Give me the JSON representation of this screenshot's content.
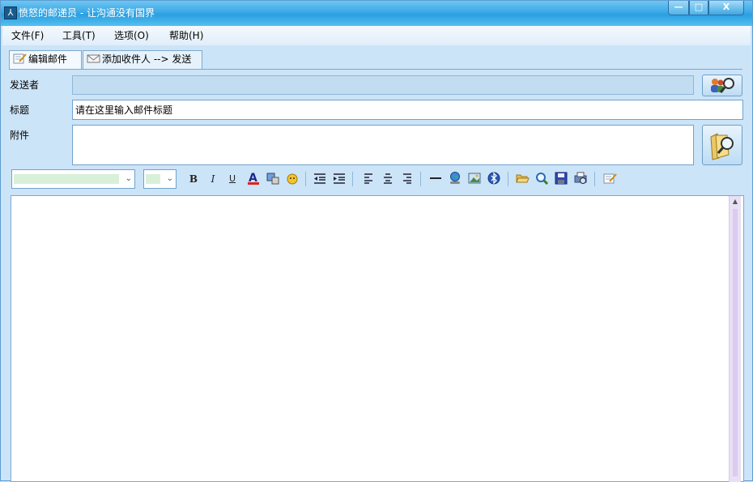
{
  "window": {
    "title": "愤怒的邮递员 - 让沟通没有国界",
    "minimize_glyph": "—",
    "maximize_glyph": "□",
    "close_glyph": "X"
  },
  "menu": {
    "file": "文件(F)",
    "tools": "工具(T)",
    "options": "选项(O)",
    "help": "帮助(H)"
  },
  "tabs": {
    "edit_mail": "编辑邮件",
    "add_recipients": "添加收件人 --> 发送"
  },
  "form": {
    "sender_label": "发送者",
    "subject_label": "标题",
    "subject_value": "请在这里输入邮件标题",
    "attachment_label": "附件"
  },
  "format_toolbar": {
    "bold": "B",
    "italic": "I",
    "underline": "U"
  },
  "colors": {
    "titlebar": "#3aa9e6",
    "window_bg": "#cce4f7",
    "accent": "#2a5d8f"
  }
}
